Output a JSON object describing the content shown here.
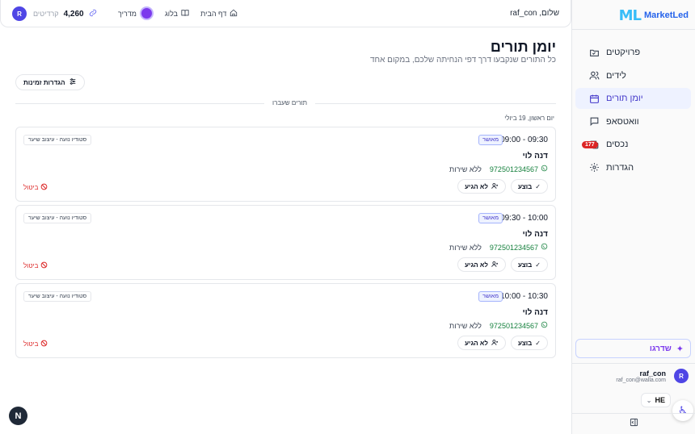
{
  "brand": {
    "mark": "ML",
    "name": "MarketLed"
  },
  "sidebar": {
    "items": [
      {
        "label": "פרויקטים",
        "icon": "folder-icon"
      },
      {
        "label": "לידים",
        "icon": "users-icon"
      },
      {
        "label": "יומן תורים",
        "icon": "calendar-icon",
        "active": true
      },
      {
        "label": "וואטסאפ",
        "icon": "chat-icon"
      },
      {
        "label": "נכסים",
        "icon": "copy-icon",
        "badge": "177"
      },
      {
        "label": "הגדרות",
        "icon": "gear-icon"
      }
    ],
    "upgrade_label": "שדרגו",
    "user": {
      "initial": "R",
      "name": "raf_con",
      "email": "raf_con@walla.com"
    },
    "lang": "HE"
  },
  "header": {
    "greeting": "שלום, raf_con",
    "nav": [
      {
        "label": "דף הבית",
        "icon": "home-icon"
      },
      {
        "label": "בלוג",
        "icon": "book-icon"
      },
      {
        "label": "מדריך",
        "icon": "guide-avatar"
      }
    ],
    "credits_label": "קרדיטים",
    "credits_value": "4,260",
    "user_initial": "R"
  },
  "page": {
    "title": "יומן תורים",
    "subtitle": "כל התורים שנקבעו דרך דפי הנחיתה שלכם, במקום אחד",
    "settings_button": "הגדרות זמינות",
    "section_label": "תורים שעברו",
    "day_label": "יום ראשון, 19 ביולי"
  },
  "appointments": [
    {
      "time": "09:00 - 09:30",
      "status": "מאושר",
      "studio": "סטודיו נועה - עיצוב שיער",
      "name": "דנה לוי",
      "phone": "972501234567",
      "service": "ללא שירות",
      "done": "בוצע",
      "noshow": "לא הגיע",
      "cancel": "ביטול"
    },
    {
      "time": "09:30 - 10:00",
      "status": "מאושר",
      "studio": "סטודיו נועה - עיצוב שיער",
      "name": "דנה לוי",
      "phone": "972501234567",
      "service": "ללא שירות",
      "done": "בוצע",
      "noshow": "לא הגיע",
      "cancel": "ביטול"
    },
    {
      "time": "10:00 - 10:30",
      "status": "מאושר",
      "studio": "סטודיו נועה - עיצוב שיער",
      "name": "דנה לוי",
      "phone": "972501234567",
      "service": "ללא שירות",
      "done": "בוצע",
      "noshow": "לא הגיע",
      "cancel": "ביטול"
    }
  ],
  "fab_label": "N"
}
